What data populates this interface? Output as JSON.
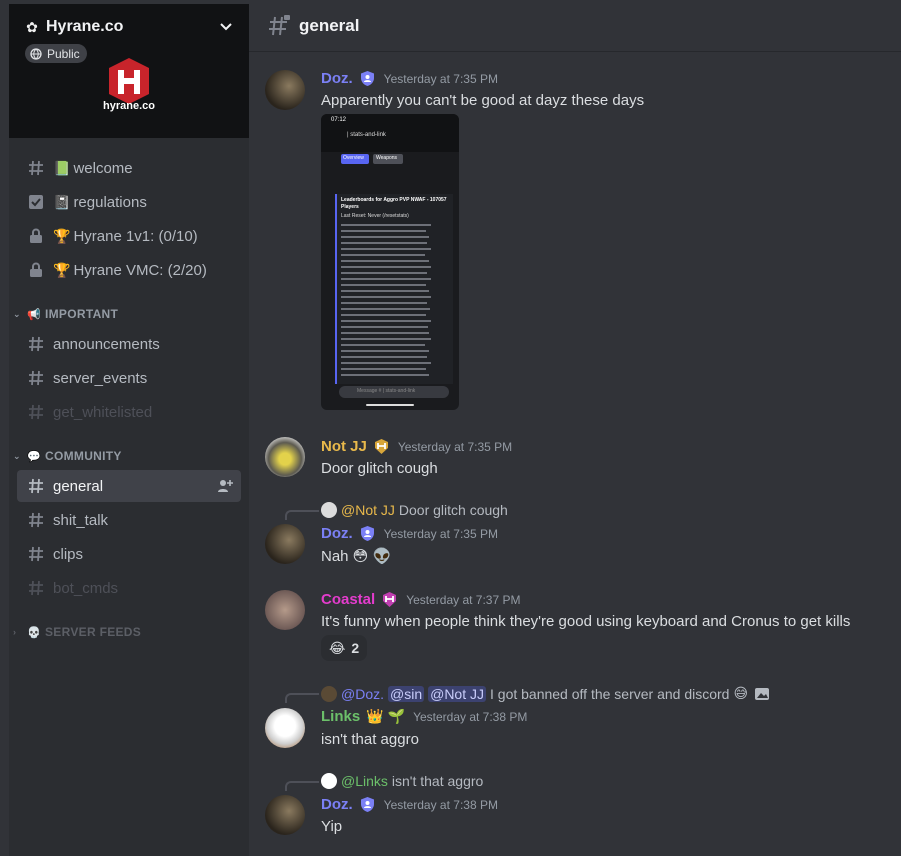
{
  "server": {
    "name": "Hyrane.co",
    "visibility": "Public",
    "logo_text": "hyrane.co"
  },
  "sidebar": {
    "channels": [
      {
        "name": "welcome",
        "emoji": "📗",
        "icon": "hash-icon"
      },
      {
        "name": "regulations",
        "emoji": "📓",
        "icon": "rules-checkbox-icon"
      },
      {
        "name": "Hyrane 1v1: (0/10)",
        "emoji": "🏆",
        "icon": "lock-icon"
      },
      {
        "name": "Hyrane VMC: (2/20)",
        "emoji": "🏆",
        "icon": "lock-icon"
      }
    ],
    "categories": [
      {
        "name": "IMPORTANT",
        "emoji": "📢",
        "channels": [
          {
            "name": "announcements"
          },
          {
            "name": "server_events"
          },
          {
            "name": "get_whitelisted"
          }
        ]
      },
      {
        "name": "COMMUNITY",
        "emoji": "💬",
        "channels": [
          {
            "name": "general"
          },
          {
            "name": "shit_talk"
          },
          {
            "name": "clips"
          },
          {
            "name": "bot_cmds"
          }
        ]
      },
      {
        "name": "SERVER FEEDS",
        "emoji": "💀",
        "channels": []
      }
    ]
  },
  "channel": {
    "title": "general"
  },
  "messages": [
    {
      "author": "Doz.",
      "author_color": "#7b80f5",
      "timestamp": "Yesterday at 7:35 PM",
      "text": "Apparently you can't be good at dayz these days",
      "attachment": {
        "status_time": "07:12",
        "header": "| stats-and-link",
        "tab1": "Overview",
        "tab2": "Weapons",
        "title": "Leaderboards for Aggro PVP NWAF - 107057 Players",
        "reset": "Last Reset: Never (/resetstats)",
        "composer": "Message # | stats-and-link"
      }
    },
    {
      "author": "Not JJ",
      "author_color": "#e9b94b",
      "timestamp": "Yesterday at 7:35 PM",
      "text": "Door glitch cough"
    },
    {
      "reply_author": "@Not JJ",
      "reply_text": "Door glitch cough",
      "author": "Doz.",
      "author_color": "#7b80f5",
      "timestamp": "Yesterday at 7:35 PM",
      "text": "Nah 😳 👽"
    },
    {
      "author": "Coastal",
      "author_color": "#e33ccc",
      "timestamp": "Yesterday at 7:37 PM",
      "text": "It's funny when people think they're good using keyboard and Cronus to get kills",
      "reaction_emoji": "😂",
      "reaction_count": "2"
    },
    {
      "reply_author": "@Doz.",
      "reply_mention1": "@sin",
      "reply_mention2": "@Not JJ",
      "reply_text": "I got banned off the server and discord",
      "author": "Links",
      "author_color": "#6cc06a",
      "timestamp": "Yesterday at 7:38 PM",
      "text": "isn't that aggro"
    },
    {
      "reply_author": "@Links",
      "reply_text": "isn't that aggro",
      "author": "Doz.",
      "author_color": "#7b80f5",
      "timestamp": "Yesterday at 7:38 PM",
      "text": "Yip"
    }
  ]
}
